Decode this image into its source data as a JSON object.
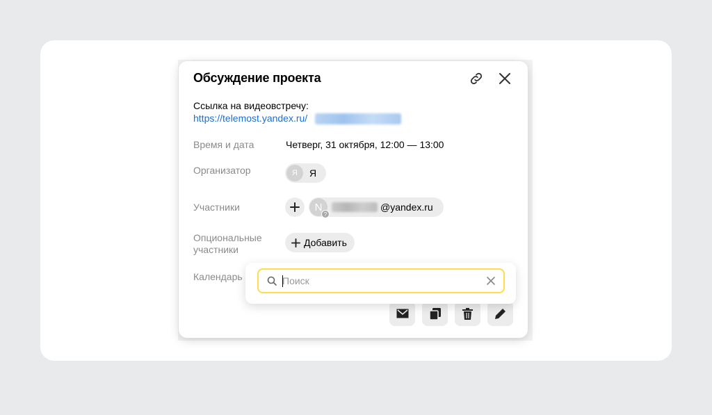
{
  "event": {
    "title": "Обсуждение проекта",
    "meeting_link_label": "Ссылка на видеовстречу:",
    "meeting_link_url": "https://telemost.yandex.ru/"
  },
  "fields": {
    "datetime_label": "Время и дата",
    "datetime_value": "Четверг, 31 октября, 12:00 — 13:00",
    "organizer_label": "Организатор",
    "organizer_avatar": "Я",
    "organizer_name": "Я",
    "participants_label": "Участники",
    "participant_avatar": "N",
    "participant_badge": "?",
    "participant_email_domain": "@yandex.ru",
    "optional_label_line1": "Опциональные",
    "optional_label_line2": "участники",
    "add_button_label": "Добавить",
    "calendar_label": "Календарь"
  },
  "search": {
    "placeholder": "Поиск",
    "value": ""
  },
  "icons": {
    "header": [
      "link-icon",
      "close-icon"
    ],
    "actions": [
      "mail-icon",
      "copy-icon",
      "trash-icon",
      "pencil-icon"
    ]
  },
  "colors": {
    "link": "#1a6ed6",
    "search_border": "#ffdb4d",
    "chip_bg": "#ececec",
    "page_bg": "#e9eaec"
  }
}
